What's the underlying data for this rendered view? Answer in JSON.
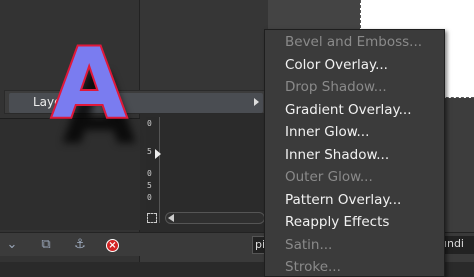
{
  "parent_menu": {
    "item_label": "Layer Effects"
  },
  "layer_thumbnail": {
    "glyph": "A",
    "fill_color": "#7a7cf0",
    "stroke_color": "#e0183a"
  },
  "submenu": {
    "items": [
      {
        "label": "Bevel and Emboss...",
        "enabled": false
      },
      {
        "label": "Color Overlay...",
        "enabled": true
      },
      {
        "label": "Drop Shadow...",
        "enabled": false
      },
      {
        "label": "Gradient Overlay...",
        "enabled": true
      },
      {
        "label": "Inner Glow...",
        "enabled": true
      },
      {
        "label": "Inner Shadow...",
        "enabled": true
      },
      {
        "label": "Outer Glow...",
        "enabled": false
      },
      {
        "label": "Pattern Overlay...",
        "enabled": true
      },
      {
        "label": "Reapply Effects",
        "enabled": true
      },
      {
        "label": "Satin...",
        "enabled": false
      },
      {
        "label": "Stroke...",
        "enabled": false
      }
    ]
  },
  "ruler": {
    "marks": [
      "0",
      "5",
      "0",
      "5",
      "0"
    ]
  },
  "layers_toolbar": {
    "icons": [
      "chevron-down-icon",
      "duplicate-layer-icon",
      "anchor-icon",
      "delete-layer-icon"
    ],
    "delete_glyph": "×"
  },
  "bottom_bar": {
    "left_field": "pi",
    "right_text": "undi"
  },
  "colors": {
    "menu_bg": "#3b3b3b",
    "enabled_text": "#f2f2f2",
    "disabled_text": "#8a8a8a",
    "delete_red": "#d42424"
  }
}
